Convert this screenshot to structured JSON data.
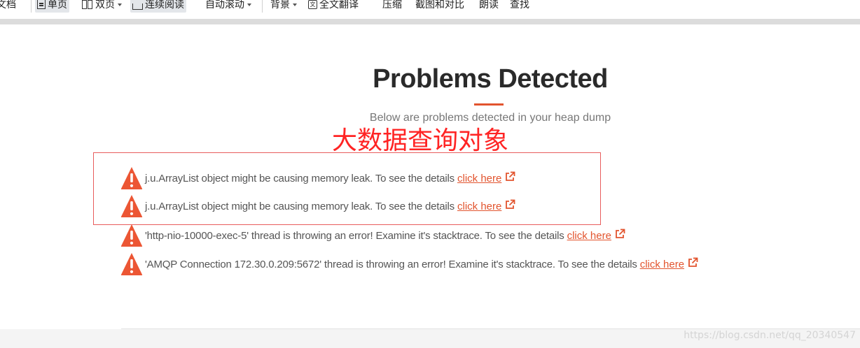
{
  "toolbar": {
    "doc_label": "文档",
    "single_page": "单页",
    "double_page": "双页",
    "continuous": "连续阅读",
    "auto_scroll": "自动滚动",
    "background": "背景",
    "full_translate": "全文翻译",
    "compress": "压缩",
    "screenshot_compare": "截图和对比",
    "read_aloud": "朗读",
    "find": "查找"
  },
  "report": {
    "title": "Problems Detected",
    "subtitle": "Below are problems detected in your heap dump",
    "link_label": "click here",
    "problems": [
      {
        "text": "j.u.ArrayList object might be causing memory leak. To see the details"
      },
      {
        "text": "j.u.ArrayList object might be causing memory leak. To see the details"
      },
      {
        "text": "'http-nio-10000-exec-5' thread is throwing an error! Examine it's stacktrace. To see the details"
      },
      {
        "text": "'AMQP Connection 172.30.0.209:5672' thread is throwing an error! Examine it's stacktrace. To see the details"
      }
    ]
  },
  "annotation": {
    "text": "大数据查询对象",
    "color": "#ff2424"
  },
  "watermark": "https://blog.csdn.net/qq_20340547",
  "colors": {
    "accent": "#e2542e",
    "warning": "#ec5634"
  }
}
